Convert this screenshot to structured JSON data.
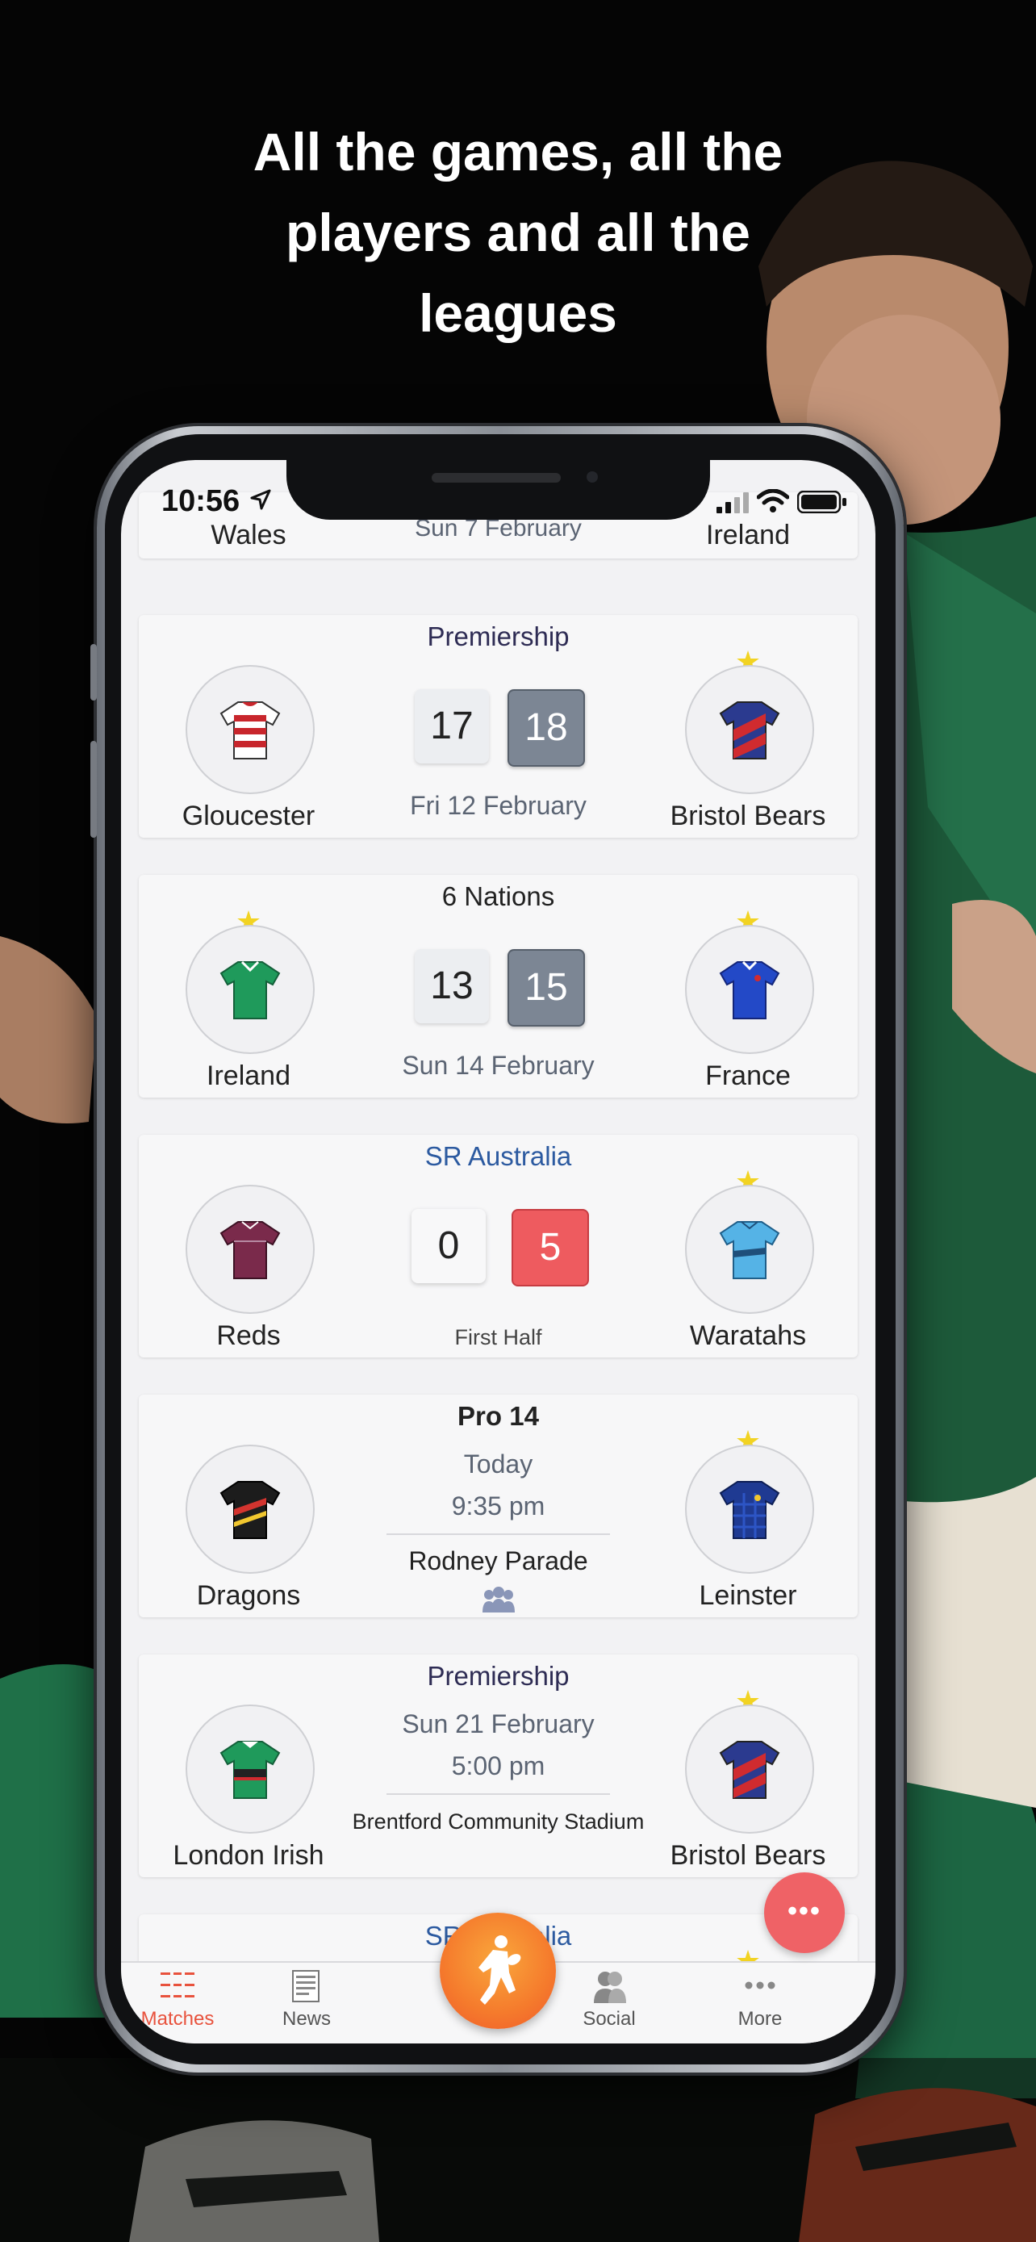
{
  "headline": {
    "line1": "All the games, all the",
    "line2": "players and all the",
    "line3": "leagues"
  },
  "status_bar": {
    "time": "10:56"
  },
  "partial_top_card": {
    "home": "Wales",
    "date": "Sun 7 February",
    "away": "Ireland"
  },
  "matches": [
    {
      "league": "Premiership",
      "home": "Gloucester",
      "away": "Bristol Bears",
      "home_score": "17",
      "away_score": "18",
      "date": "Fri 12 February",
      "home_fav": false,
      "away_fav": true
    },
    {
      "league": "6 Nations",
      "home": "Ireland",
      "away": "France",
      "home_score": "13",
      "away_score": "15",
      "date": "Sun 14 February",
      "home_fav": true,
      "away_fav": true
    },
    {
      "league": "SR Australia",
      "home": "Reds",
      "away": "Waratahs",
      "home_score": "0",
      "away_score": "5",
      "status": "First Half",
      "home_fav": false,
      "away_fav": true
    },
    {
      "league": "Pro 14",
      "home": "Dragons",
      "away": "Leinster",
      "day": "Today",
      "kickoff": "9:35 pm",
      "venue": "Rodney Parade",
      "home_fav": false,
      "away_fav": true
    },
    {
      "league": "Premiership",
      "home": "London Irish",
      "away": "Bristol Bears",
      "day": "Sun 21 February",
      "kickoff": "5:00 pm",
      "venue": "Brentford Community Stadium",
      "home_fav": false,
      "away_fav": true
    },
    {
      "league": "SR Australia"
    }
  ],
  "fab": {
    "label": "•••"
  },
  "tabbar": {
    "matches": "Matches",
    "news": "News",
    "social": "Social",
    "more": "More"
  },
  "colors": {
    "accent": "#e8523d",
    "live_score": "#ee5b5f",
    "final_score": "#7c8694",
    "star": "#f2d322",
    "league_blue": "#2c5aa0"
  }
}
